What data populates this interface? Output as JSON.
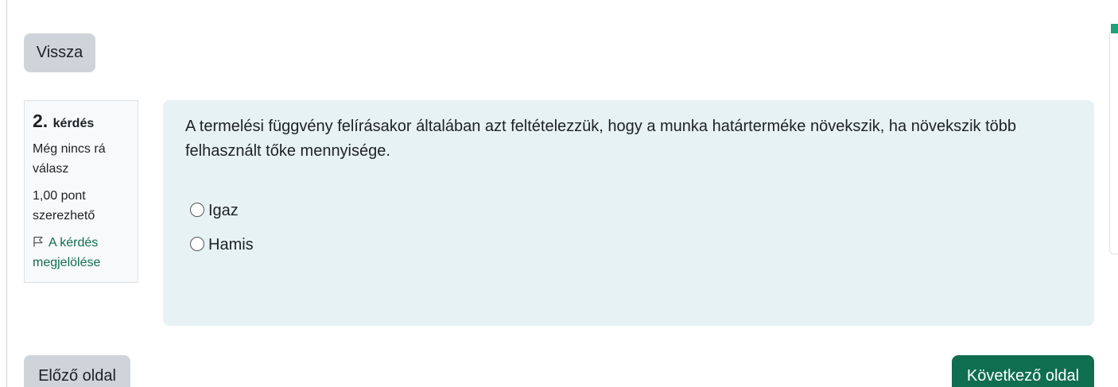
{
  "navigation": {
    "back_label": "Vissza",
    "prev_label": "Előző oldal",
    "next_label": "Következő oldal"
  },
  "question_info": {
    "number": "2.",
    "number_word": "kérdés",
    "state": "Még nincs rá válasz",
    "grade": "1,00 pont szerezhető",
    "flag_label": "A kérdés megjelölése",
    "flag_icon": "flag-icon"
  },
  "question": {
    "text": "A termelési függvény felírásakor általában azt feltételezzük, hogy a munka határterméke növekszik, ha növekszik több felhasznált tőke mennyisége.",
    "options": [
      {
        "label": "Igaz",
        "selected": false
      },
      {
        "label": "Hamis",
        "selected": false
      }
    ]
  },
  "colors": {
    "primary": "#0f6e50",
    "secondary_button": "#ced4da",
    "question_bg": "#e7f2f4",
    "info_bg": "#f8f9fa"
  }
}
